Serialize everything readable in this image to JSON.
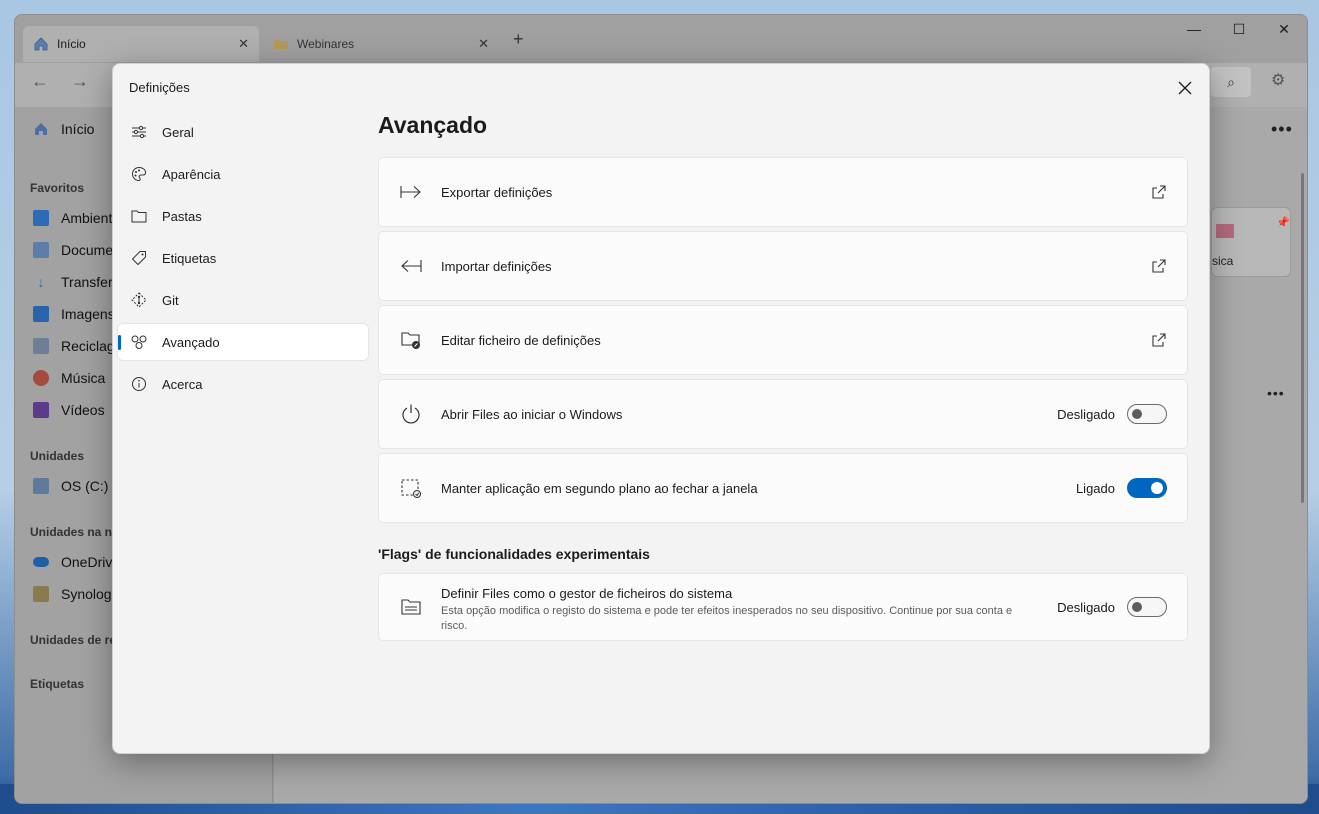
{
  "tabs": [
    {
      "title": "Início"
    },
    {
      "title": "Webinares"
    }
  ],
  "sidebar": {
    "items": [
      {
        "label": "Início"
      },
      {
        "label": "Ambient"
      },
      {
        "label": "Docume"
      },
      {
        "label": "Transfer"
      },
      {
        "label": "Imagens"
      },
      {
        "label": "Reciclag"
      },
      {
        "label": "Música"
      },
      {
        "label": "Vídeos"
      },
      {
        "label": "OS (C:)"
      },
      {
        "label": "OneDriv"
      },
      {
        "label": "Synolog"
      }
    ],
    "sections": [
      "Favoritos",
      "Unidades",
      "Unidades na nu",
      "Unidades de re",
      "Etiquetas"
    ]
  },
  "background_card": {
    "label": "sica"
  },
  "dialog": {
    "title": "Definições",
    "nav": [
      {
        "label": "Geral",
        "icon": "sliders-icon"
      },
      {
        "label": "Aparência",
        "icon": "palette-icon"
      },
      {
        "label": "Pastas",
        "icon": "folder-icon"
      },
      {
        "label": "Etiquetas",
        "icon": "tag-icon"
      },
      {
        "label": "Git",
        "icon": "git-icon"
      },
      {
        "label": "Avançado",
        "icon": "advanced-icon",
        "selected": true
      },
      {
        "label": "Acerca",
        "icon": "info-icon"
      }
    ],
    "page_title": "Avançado",
    "rows": [
      {
        "label": "Exportar definições",
        "icon": "export-icon"
      },
      {
        "label": "Importar definições",
        "icon": "import-icon"
      },
      {
        "label": "Editar ficheiro de definições",
        "icon": "edit-settings-file-icon"
      },
      {
        "label": "Abrir Files ao iniciar o Windows",
        "icon": "power-icon",
        "state": "Desligado",
        "on": false
      },
      {
        "label": "Manter aplicação em segundo plano ao fechar a janela",
        "icon": "background-app-icon",
        "state": "Ligado",
        "on": true
      }
    ],
    "experimental": {
      "heading": "'Flags' de funcionalidades experimentais",
      "label": "Definir Files como o gestor de ficheiros do sistema",
      "description": "Esta opção modifica o registo do sistema e pode ter efeitos inesperados no seu dispositivo. Continue por sua conta e risco.",
      "state": "Desligado",
      "on": false
    }
  },
  "colors": {
    "accent": "#0067c0"
  }
}
